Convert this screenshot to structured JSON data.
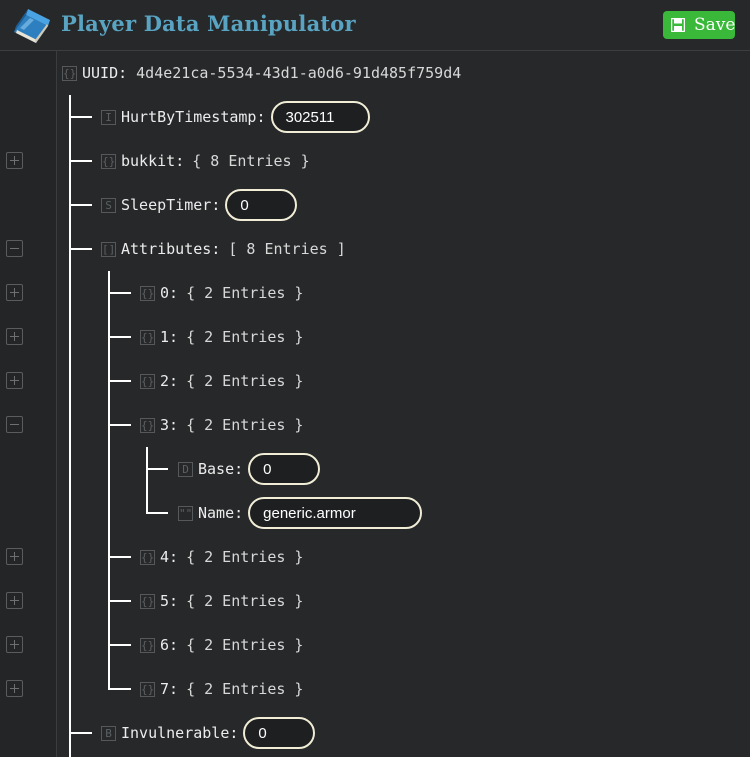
{
  "app": {
    "title": "Player Data Manipulator",
    "save_label": "Save",
    "accent_color": "#5aa4c3",
    "save_color": "#39b83a"
  },
  "tree": {
    "root": {
      "key": "UUID",
      "value": "4d4e21ca-5534-43d1-a0d6-91d485f759d4",
      "icon": "compound-icon"
    },
    "hurt": {
      "key": "HurtByTimestamp",
      "value": "302511",
      "icon": "int-icon"
    },
    "bukkit": {
      "key": "bukkit",
      "summary": "{ 8 Entries }",
      "icon": "compound-icon"
    },
    "sleep": {
      "key": "SleepTimer",
      "value": "0",
      "icon": "short-icon"
    },
    "attributes": {
      "key": "Attributes",
      "summary": "[ 8 Entries ]",
      "icon": "list-icon"
    },
    "attr_items": [
      {
        "key": "0",
        "summary": "{ 2 Entries }"
      },
      {
        "key": "1",
        "summary": "{ 2 Entries }"
      },
      {
        "key": "2",
        "summary": "{ 2 Entries }"
      },
      {
        "key": "3",
        "summary": "{ 2 Entries }"
      },
      {
        "key": "4",
        "summary": "{ 2 Entries }"
      },
      {
        "key": "5",
        "summary": "{ 2 Entries }"
      },
      {
        "key": "6",
        "summary": "{ 2 Entries }"
      },
      {
        "key": "7",
        "summary": "{ 2 Entries }"
      }
    ],
    "attr3_base": {
      "key": "Base",
      "value": "0",
      "icon": "double-icon"
    },
    "attr3_name": {
      "key": "Name",
      "value": "generic.armor",
      "icon": "string-icon"
    },
    "invulnerable": {
      "key": "Invulnerable",
      "value": "0",
      "icon": "byte-icon"
    }
  },
  "icons": {
    "compound": "{}",
    "int": "I",
    "short": "S",
    "list": "[]",
    "double": "D",
    "string": "\"\"",
    "byte": "B"
  }
}
